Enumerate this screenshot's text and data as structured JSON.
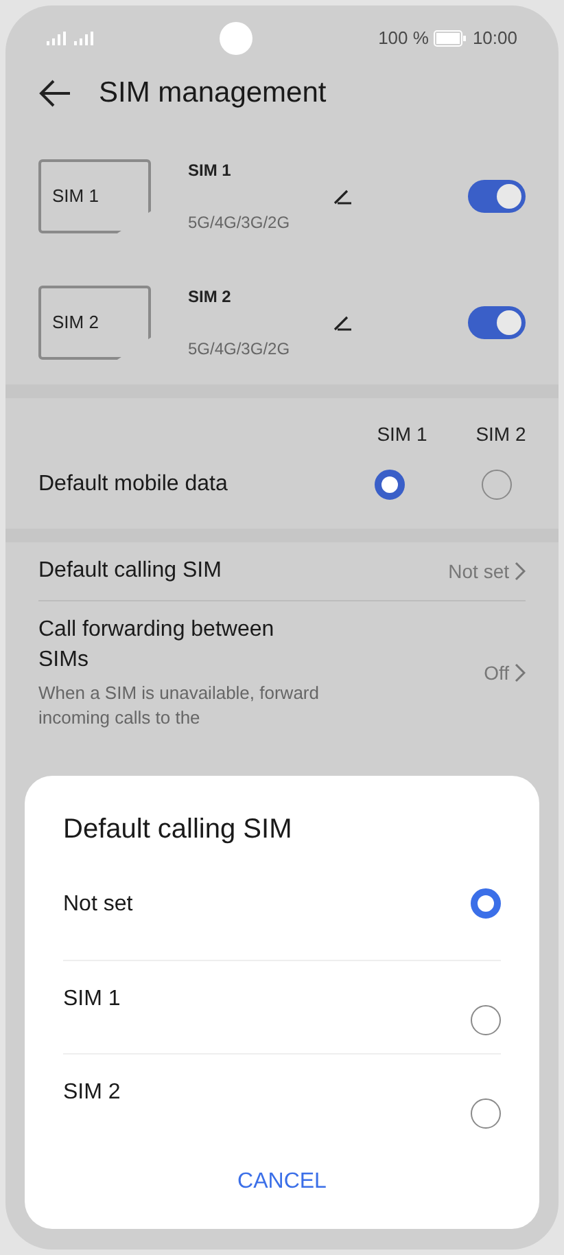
{
  "status_bar": {
    "battery": "100 %",
    "time": "10:00"
  },
  "header": {
    "title": "SIM management"
  },
  "sims": [
    {
      "card_label": "SIM 1",
      "name": "SIM 1",
      "networks": "5G/4G/3G/2G",
      "on": true
    },
    {
      "card_label": "SIM 2",
      "name": "SIM 2",
      "networks": "5G/4G/3G/2G",
      "on": true
    }
  ],
  "default_data": {
    "columns": [
      "SIM 1",
      "SIM 2"
    ],
    "label": "Default mobile data",
    "options": [
      {
        "selected": true
      },
      {
        "selected": false
      }
    ]
  },
  "settings": [
    {
      "title": "Default calling SIM",
      "value": "Not set"
    },
    {
      "title": "Call forwarding between SIMs",
      "subtitle": "When a SIM is unavailable, forward incoming calls to the",
      "value": "Off"
    }
  ],
  "dialog": {
    "title": "Default calling SIM",
    "options": [
      {
        "label": "Not set",
        "selected": true
      },
      {
        "label": "SIM 1",
        "selected": false
      },
      {
        "label": "SIM 2",
        "selected": false
      }
    ],
    "button": "CANCEL"
  }
}
